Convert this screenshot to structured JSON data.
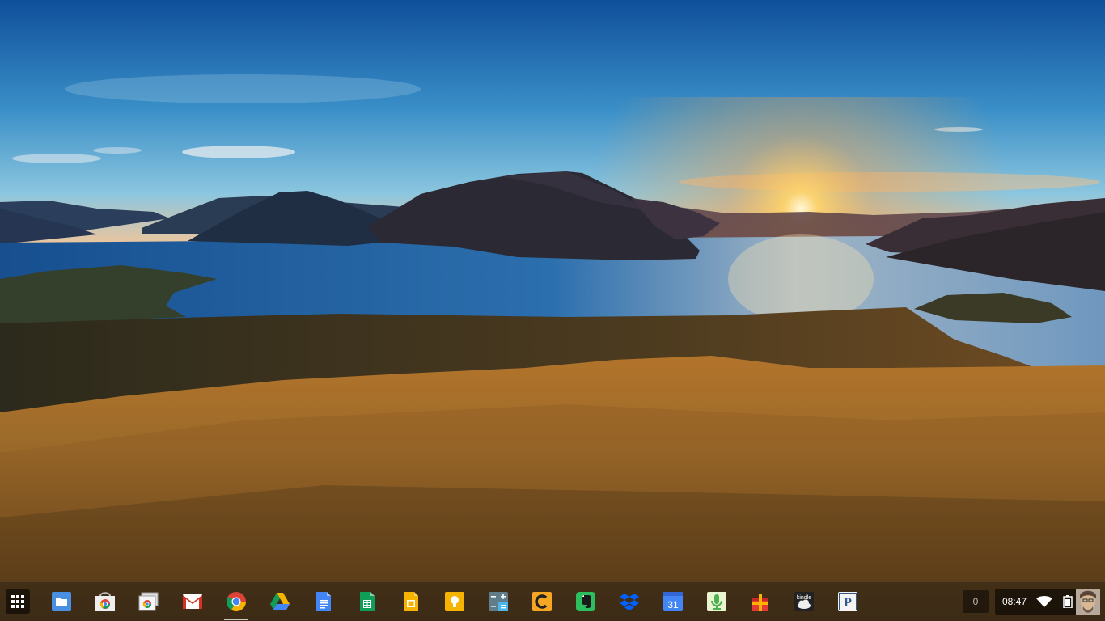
{
  "wallpaper": {
    "icon": "landscape-lake-sunset-wallpaper"
  },
  "shelf": {
    "launcher": {
      "icon": "app-launcher-grid-icon"
    },
    "apps": [
      {
        "id": "files",
        "icon": "files-folder-icon",
        "running": false
      },
      {
        "id": "web-store",
        "icon": "chrome-web-store-icon",
        "running": false
      },
      {
        "id": "tabs",
        "icon": "browser-windows-icon",
        "running": false
      },
      {
        "id": "gmail",
        "icon": "gmail-icon",
        "running": false
      },
      {
        "id": "chrome",
        "icon": "chrome-icon",
        "running": true
      },
      {
        "id": "drive",
        "icon": "google-drive-icon",
        "running": false
      },
      {
        "id": "docs",
        "icon": "google-docs-icon",
        "running": false
      },
      {
        "id": "sheets",
        "icon": "google-sheets-icon",
        "running": false
      },
      {
        "id": "slides",
        "icon": "google-slides-icon",
        "running": false
      },
      {
        "id": "keep",
        "icon": "google-keep-icon",
        "running": false
      },
      {
        "id": "calculator",
        "icon": "calculator-icon",
        "running": false
      },
      {
        "id": "caret",
        "icon": "caret-editor-icon",
        "running": false
      },
      {
        "id": "evernote",
        "icon": "evernote-icon",
        "running": false
      },
      {
        "id": "dropbox",
        "icon": "dropbox-icon",
        "running": false
      },
      {
        "id": "calendar",
        "icon": "google-calendar-icon",
        "label": "31",
        "running": false
      },
      {
        "id": "voice",
        "icon": "voice-recorder-icon",
        "running": false
      },
      {
        "id": "gift-app",
        "icon": "gift-box-icon",
        "running": false
      },
      {
        "id": "kindle",
        "icon": "kindle-cloud-reader-icon",
        "label": "kindle",
        "running": false
      },
      {
        "id": "pandora",
        "icon": "pandora-icon",
        "label": "P",
        "running": false
      }
    ]
  },
  "status": {
    "notifications_count": "0",
    "time": "08:47",
    "wifi_icon": "wifi-icon",
    "battery_icon": "battery-icon",
    "avatar_icon": "user-avatar-icon"
  }
}
